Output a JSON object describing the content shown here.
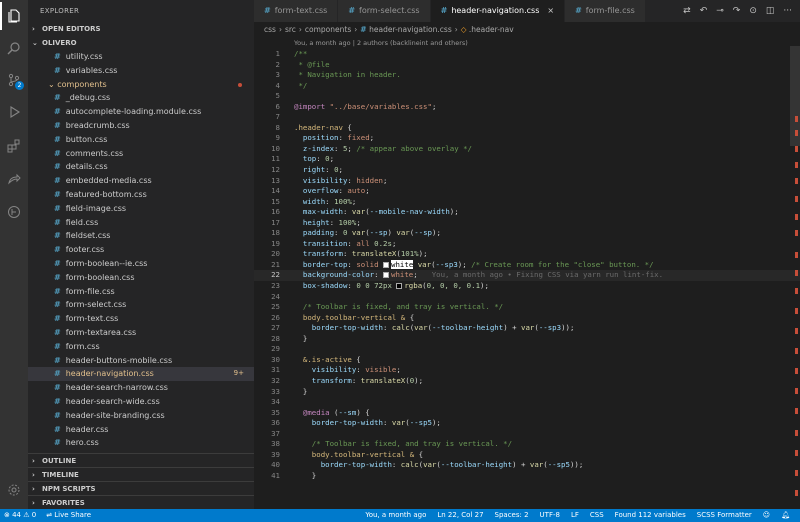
{
  "sidebar": {
    "title": "EXPLORER",
    "open_editors": "OPEN EDITORS",
    "project": "OLIVERO",
    "files": [
      {
        "name": "utility.css",
        "type": "file"
      },
      {
        "name": "variables.css",
        "type": "file"
      },
      {
        "name": "components",
        "type": "folder"
      },
      {
        "name": "_debug.css",
        "type": "file"
      },
      {
        "name": "autocomplete-loading.module.css",
        "type": "file"
      },
      {
        "name": "breadcrumb.css",
        "type": "file"
      },
      {
        "name": "button.css",
        "type": "file"
      },
      {
        "name": "comments.css",
        "type": "file"
      },
      {
        "name": "details.css",
        "type": "file"
      },
      {
        "name": "embedded-media.css",
        "type": "file"
      },
      {
        "name": "featured-bottom.css",
        "type": "file"
      },
      {
        "name": "field-image.css",
        "type": "file"
      },
      {
        "name": "field.css",
        "type": "file"
      },
      {
        "name": "fieldset.css",
        "type": "file"
      },
      {
        "name": "footer.css",
        "type": "file"
      },
      {
        "name": "form-boolean--ie.css",
        "type": "file"
      },
      {
        "name": "form-boolean.css",
        "type": "file"
      },
      {
        "name": "form-file.css",
        "type": "file"
      },
      {
        "name": "form-select.css",
        "type": "file"
      },
      {
        "name": "form-text.css",
        "type": "file"
      },
      {
        "name": "form-textarea.css",
        "type": "file"
      },
      {
        "name": "form.css",
        "type": "file"
      },
      {
        "name": "header-buttons-mobile.css",
        "type": "file"
      },
      {
        "name": "header-navigation.css",
        "type": "selected",
        "count": "9+"
      },
      {
        "name": "header-search-narrow.css",
        "type": "file"
      },
      {
        "name": "header-search-wide.css",
        "type": "file"
      },
      {
        "name": "header-site-branding.css",
        "type": "file"
      },
      {
        "name": "header.css",
        "type": "file"
      },
      {
        "name": "hero.css",
        "type": "file"
      }
    ],
    "bottom_sections": [
      "OUTLINE",
      "TIMELINE",
      "NPM SCRIPTS",
      "FAVORITES"
    ]
  },
  "tabs": [
    {
      "label": "form-text.css",
      "active": false
    },
    {
      "label": "form-select.css",
      "active": false
    },
    {
      "label": "header-navigation.css",
      "active": true
    },
    {
      "label": "form-file.css",
      "active": false
    }
  ],
  "breadcrumb": [
    "css",
    "src",
    "components",
    "header-navigation.css",
    ".header-nav"
  ],
  "codelens": "You, a month ago | 2 authors (backlineint and others)",
  "lines": [
    {
      "n": "1",
      "parts": [
        [
          "c-com",
          "/**"
        ]
      ]
    },
    {
      "n": "2",
      "parts": [
        [
          "c-com",
          " * @file"
        ]
      ]
    },
    {
      "n": "3",
      "parts": [
        [
          "c-com",
          " * Navigation in header."
        ]
      ]
    },
    {
      "n": "4",
      "parts": [
        [
          "c-com",
          " */"
        ]
      ]
    },
    {
      "n": "5",
      "parts": []
    },
    {
      "n": "6",
      "parts": [
        [
          "c-kw",
          "@import "
        ],
        [
          "c-str",
          "\"../base/variables.css\""
        ],
        [
          "c-punc",
          ";"
        ]
      ]
    },
    {
      "n": "7",
      "parts": []
    },
    {
      "n": "8",
      "parts": [
        [
          "c-sel",
          ".header-nav "
        ],
        [
          "c-punc",
          "{"
        ]
      ]
    },
    {
      "n": "9",
      "parts": [
        [
          "c-prop",
          "  position"
        ],
        [
          "c-punc",
          ": "
        ],
        [
          "c-val",
          "fixed"
        ],
        [
          "c-punc",
          ";"
        ]
      ]
    },
    {
      "n": "10",
      "parts": [
        [
          "c-prop",
          "  z-index"
        ],
        [
          "c-punc",
          ": "
        ],
        [
          "c-num",
          "5"
        ],
        [
          "c-punc",
          "; "
        ],
        [
          "c-com",
          "/* appear above overlay */"
        ]
      ]
    },
    {
      "n": "11",
      "parts": [
        [
          "c-prop",
          "  top"
        ],
        [
          "c-punc",
          ": "
        ],
        [
          "c-num",
          "0"
        ],
        [
          "c-punc",
          ";"
        ]
      ]
    },
    {
      "n": "12",
      "parts": [
        [
          "c-prop",
          "  right"
        ],
        [
          "c-punc",
          ": "
        ],
        [
          "c-num",
          "0"
        ],
        [
          "c-punc",
          ";"
        ]
      ]
    },
    {
      "n": "13",
      "parts": [
        [
          "c-prop",
          "  visibility"
        ],
        [
          "c-punc",
          ": "
        ],
        [
          "c-val",
          "hidden"
        ],
        [
          "c-punc",
          ";"
        ]
      ]
    },
    {
      "n": "14",
      "parts": [
        [
          "c-prop",
          "  overflow"
        ],
        [
          "c-punc",
          ": "
        ],
        [
          "c-val",
          "auto"
        ],
        [
          "c-punc",
          ";"
        ]
      ]
    },
    {
      "n": "15",
      "parts": [
        [
          "c-prop",
          "  width"
        ],
        [
          "c-punc",
          ": "
        ],
        [
          "c-num",
          "100%"
        ],
        [
          "c-punc",
          ";"
        ]
      ]
    },
    {
      "n": "16",
      "parts": [
        [
          "c-prop",
          "  max-width"
        ],
        [
          "c-punc",
          ": "
        ],
        [
          "c-fn",
          "var"
        ],
        [
          "c-punc",
          "("
        ],
        [
          "c-prop",
          "--mobile-nav-width"
        ],
        [
          "c-punc",
          ");"
        ]
      ]
    },
    {
      "n": "17",
      "parts": [
        [
          "c-prop",
          "  height"
        ],
        [
          "c-punc",
          ": "
        ],
        [
          "c-num",
          "100%"
        ],
        [
          "c-punc",
          ";"
        ]
      ]
    },
    {
      "n": "18",
      "parts": [
        [
          "c-prop",
          "  padding"
        ],
        [
          "c-punc",
          ": "
        ],
        [
          "c-num",
          "0 "
        ],
        [
          "c-fn",
          "var"
        ],
        [
          "c-punc",
          "("
        ],
        [
          "c-prop",
          "--sp"
        ],
        [
          "c-punc",
          ") "
        ],
        [
          "c-fn",
          "var"
        ],
        [
          "c-punc",
          "("
        ],
        [
          "c-prop",
          "--sp"
        ],
        [
          "c-punc",
          ");"
        ]
      ]
    },
    {
      "n": "19",
      "parts": [
        [
          "c-prop",
          "  transition"
        ],
        [
          "c-punc",
          ": "
        ],
        [
          "c-val",
          "all "
        ],
        [
          "c-num",
          "0.2s"
        ],
        [
          "c-punc",
          ";"
        ]
      ]
    },
    {
      "n": "20",
      "parts": [
        [
          "c-prop",
          "  transform"
        ],
        [
          "c-punc",
          ": "
        ],
        [
          "c-fn",
          "translateX"
        ],
        [
          "c-punc",
          "("
        ],
        [
          "c-num",
          "101%"
        ],
        [
          "c-punc",
          ");"
        ]
      ]
    },
    {
      "n": "21",
      "parts": [
        [
          "c-prop",
          "  border-top"
        ],
        [
          "c-punc",
          ": "
        ],
        [
          "c-val",
          "solid "
        ],
        [
          "swatch-white",
          ""
        ],
        [
          "hl-word",
          "white"
        ],
        [
          "c-punc",
          " "
        ],
        [
          "c-fn",
          "var"
        ],
        [
          "c-punc",
          "("
        ],
        [
          "c-prop",
          "--sp3"
        ],
        [
          "c-punc",
          "); "
        ],
        [
          "c-com",
          "/* Create room for the \"close\" button. */"
        ]
      ]
    },
    {
      "n": "22",
      "cur": true,
      "parts": [
        [
          "c-prop",
          "  background-color"
        ],
        [
          "c-punc",
          ": "
        ],
        [
          "swatch-white",
          ""
        ],
        [
          "c-val",
          "white"
        ],
        [
          "c-punc",
          ";"
        ]
      ],
      "blame": "You, a month ago • Fixing CSS via yarn run lint-fix."
    },
    {
      "n": "23",
      "parts": [
        [
          "c-prop",
          "  box-shadow"
        ],
        [
          "c-punc",
          ": "
        ],
        [
          "c-num",
          "0 0 72px "
        ],
        [
          "swatch-black",
          ""
        ],
        [
          "c-fn",
          "rgba"
        ],
        [
          "c-punc",
          "("
        ],
        [
          "c-num",
          "0, 0, 0, 0.1"
        ],
        [
          "c-punc",
          ");"
        ]
      ]
    },
    {
      "n": "24",
      "parts": []
    },
    {
      "n": "25",
      "parts": [
        [
          "c-com",
          "  /* Toolbar is fixed, and tray is vertical. */"
        ]
      ]
    },
    {
      "n": "26",
      "parts": [
        [
          "c-sel",
          "  body.toolbar-vertical & "
        ],
        [
          "c-punc",
          "{"
        ]
      ]
    },
    {
      "n": "27",
      "parts": [
        [
          "c-prop",
          "    border-top-width"
        ],
        [
          "c-punc",
          ": "
        ],
        [
          "c-fn",
          "calc"
        ],
        [
          "c-punc",
          "("
        ],
        [
          "c-fn",
          "var"
        ],
        [
          "c-punc",
          "("
        ],
        [
          "c-prop",
          "--toolbar-height"
        ],
        [
          "c-punc",
          ") + "
        ],
        [
          "c-fn",
          "var"
        ],
        [
          "c-punc",
          "("
        ],
        [
          "c-prop",
          "--sp3"
        ],
        [
          "c-punc",
          "));"
        ]
      ]
    },
    {
      "n": "28",
      "parts": [
        [
          "c-punc",
          "  }"
        ]
      ]
    },
    {
      "n": "29",
      "parts": []
    },
    {
      "n": "30",
      "parts": [
        [
          "c-sel",
          "  &.is-active "
        ],
        [
          "c-punc",
          "{"
        ]
      ]
    },
    {
      "n": "31",
      "parts": [
        [
          "c-prop",
          "    visibility"
        ],
        [
          "c-punc",
          ": "
        ],
        [
          "c-val",
          "visible"
        ],
        [
          "c-punc",
          ";"
        ]
      ]
    },
    {
      "n": "32",
      "parts": [
        [
          "c-prop",
          "    transform"
        ],
        [
          "c-punc",
          ": "
        ],
        [
          "c-fn",
          "translateX"
        ],
        [
          "c-punc",
          "("
        ],
        [
          "c-num",
          "0"
        ],
        [
          "c-punc",
          ");"
        ]
      ]
    },
    {
      "n": "33",
      "parts": [
        [
          "c-punc",
          "  }"
        ]
      ]
    },
    {
      "n": "34",
      "parts": []
    },
    {
      "n": "35",
      "parts": [
        [
          "c-kw",
          "  @media "
        ],
        [
          "c-punc",
          "("
        ],
        [
          "c-prop",
          "--sm"
        ],
        [
          "c-punc",
          ") {"
        ]
      ]
    },
    {
      "n": "36",
      "parts": [
        [
          "c-prop",
          "    border-top-width"
        ],
        [
          "c-punc",
          ": "
        ],
        [
          "c-fn",
          "var"
        ],
        [
          "c-punc",
          "("
        ],
        [
          "c-prop",
          "--sp5"
        ],
        [
          "c-punc",
          ");"
        ]
      ]
    },
    {
      "n": "37",
      "parts": []
    },
    {
      "n": "38",
      "parts": [
        [
          "c-com",
          "    /* Toolbar is fixed, and tray is vertical. */"
        ]
      ]
    },
    {
      "n": "39",
      "parts": [
        [
          "c-sel",
          "    body.toolbar-vertical & "
        ],
        [
          "c-punc",
          "{"
        ]
      ]
    },
    {
      "n": "40",
      "parts": [
        [
          "c-prop",
          "      border-top-width"
        ],
        [
          "c-punc",
          ": "
        ],
        [
          "c-fn",
          "calc"
        ],
        [
          "c-punc",
          "("
        ],
        [
          "c-fn",
          "var"
        ],
        [
          "c-punc",
          "("
        ],
        [
          "c-prop",
          "--toolbar-height"
        ],
        [
          "c-punc",
          ") + "
        ],
        [
          "c-fn",
          "var"
        ],
        [
          "c-punc",
          "("
        ],
        [
          "c-prop",
          "--sp5"
        ],
        [
          "c-punc",
          "));"
        ]
      ]
    },
    {
      "n": "41",
      "parts": [
        [
          "c-punc",
          "    }"
        ]
      ]
    }
  ],
  "status": {
    "problems": "⊗ 44 ⚠ 0",
    "live_share": "Live Share",
    "blame": "You, a month ago",
    "position": "Ln 22, Col 27",
    "spaces": "Spaces: 2",
    "encoding": "UTF-8",
    "eol": "LF",
    "language": "CSS",
    "variables": "Found 112 variables",
    "formatter": "SCSS Formatter"
  },
  "activity_badge": "2"
}
